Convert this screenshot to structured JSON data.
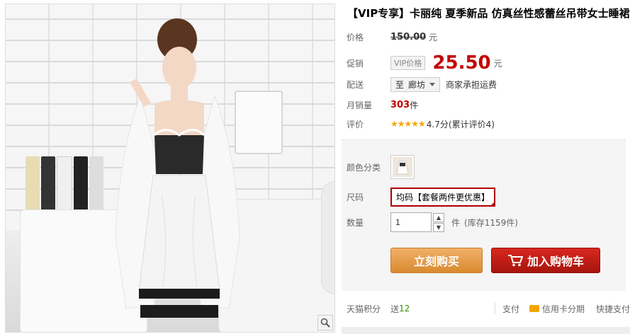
{
  "product": {
    "title": "【VIP专享】卡丽纯 夏季新品 仿真丝性感蕾丝吊带女士睡裙"
  },
  "price": {
    "label": "价格",
    "original": "150.00",
    "unit": "元"
  },
  "promo": {
    "label": "促销",
    "tag": "VIP价格",
    "price": "25.50",
    "unit": "元"
  },
  "shipping": {
    "label": "配送",
    "to_prefix": "至",
    "city": "廊坊",
    "note": "商家承担运费"
  },
  "sales": {
    "label": "月销量",
    "count": "303",
    "unit": "件"
  },
  "rating": {
    "label": "评价",
    "stars": "★★★★★",
    "text": "4.7分(累计评价4)"
  },
  "options": {
    "color_label": "颜色分类",
    "size_label": "尺码",
    "size_value": "均码【套餐两件更优惠】",
    "qty_label": "数量",
    "qty_value": "1",
    "qty_unit": "件",
    "stock": "(库存1159件)"
  },
  "actions": {
    "buy_now": "立刻购买",
    "add_cart": "加入购物车"
  },
  "footer": {
    "points_label": "天猫积分",
    "points_prefix": "送",
    "points_value": "12",
    "pay_label": "支付",
    "installment": "信用卡分期",
    "quick_pay": "快捷支付"
  },
  "colors": {
    "accent_red": "#c40000",
    "buy_orange": "#d98a2f",
    "cart_red": "#a8140e",
    "star_gold": "#f7a600"
  },
  "icons": {
    "zoom": "magnifier-icon",
    "cart": "cart-icon",
    "card": "credit-card-icon"
  }
}
